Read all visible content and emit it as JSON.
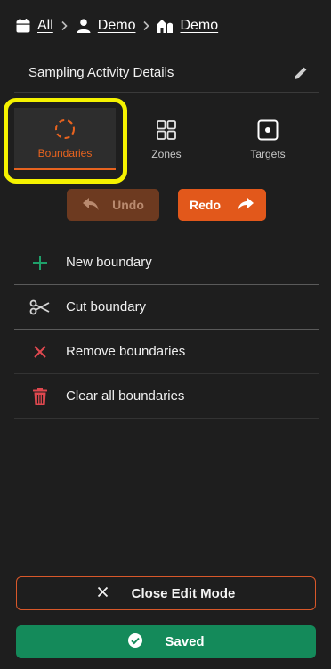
{
  "breadcrumb": {
    "items": [
      {
        "label": "All",
        "icon": "calendar-icon"
      },
      {
        "label": "Demo",
        "icon": "user-icon"
      },
      {
        "label": "Demo",
        "icon": "farm-icon"
      }
    ]
  },
  "header": {
    "title": "Sampling Activity Details",
    "edit_icon": "pencil-icon"
  },
  "tabs": [
    {
      "label": "Boundaries",
      "icon": "boundary-icon",
      "active": true
    },
    {
      "label": "Zones",
      "icon": "grid-icon",
      "active": false
    },
    {
      "label": "Targets",
      "icon": "target-icon",
      "active": false
    }
  ],
  "history": {
    "undo_label": "Undo",
    "redo_label": "Redo"
  },
  "actions": [
    {
      "label": "New boundary",
      "icon": "plus-icon"
    },
    {
      "label": "Cut boundary",
      "icon": "scissors-icon"
    },
    {
      "label": "Remove boundaries",
      "icon": "x-icon"
    },
    {
      "label": "Clear all boundaries",
      "icon": "trash-icon"
    }
  ],
  "footer": {
    "close_label": "Close Edit Mode",
    "saved_label": "Saved"
  },
  "colors": {
    "accent": "#e2581b",
    "success": "#148a5a",
    "highlight": "#f5f200",
    "danger": "#e0484f",
    "new": "#1fa06a"
  }
}
